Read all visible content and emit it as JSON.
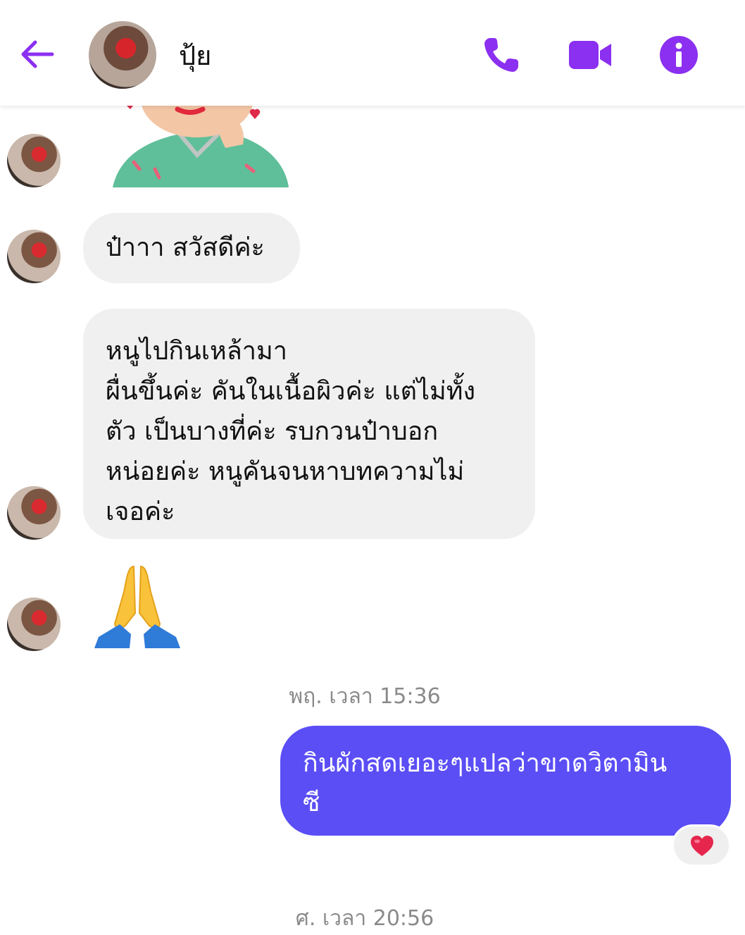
{
  "header": {
    "contact_name": "ปุ้ย"
  },
  "messages": {
    "incoming_1": "ป๋าาา สวัสดีค่ะ",
    "incoming_2": "หนูไปกินเหล้ามา\nผื่นขึ้นค่ะ คันในเนื้อผิวค่ะ แต่ไม่ทั้ง\nตัว เป็นบางที่ค่ะ รบกวนป๋าบอก\nหน่อยค่ะ หนูคันจนหาบทความไม่\nเจอค่ะ",
    "incoming_emoji": "🙏",
    "timestamp_1": "พฤ. เวลา 15:36",
    "outgoing_1": "กินผักสดเยอะๆแปลว่าขาดวิตามิน\nซี",
    "reaction": "❤️",
    "timestamp_2": "ศ. เวลา 20:56"
  },
  "colors": {
    "accent": "#8b2ff0",
    "outgoing_bubble": "#5b4ef5",
    "incoming_bubble": "#f0f0f0",
    "timestamp": "#8a8a8a"
  },
  "icons": {
    "back": "arrow-left-icon",
    "call": "phone-icon",
    "video": "video-camera-icon",
    "info": "info-icon"
  }
}
